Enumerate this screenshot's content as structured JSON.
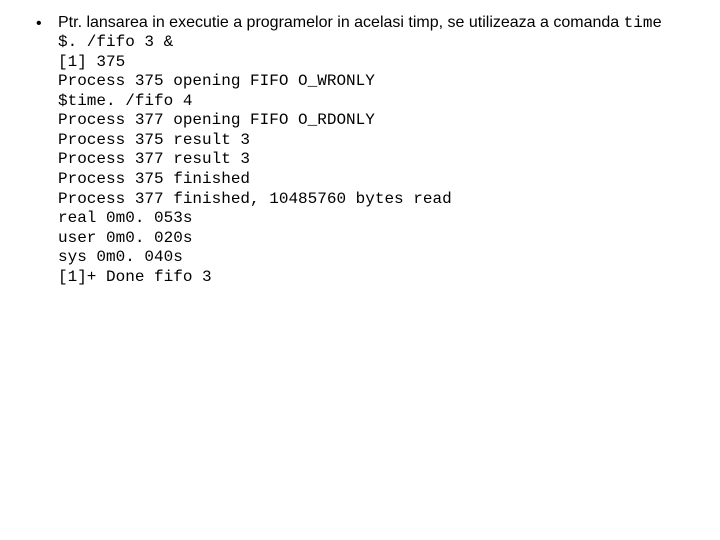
{
  "bullet": "•",
  "intro_part1": "Ptr. lansarea in executie a programelor in acelasi timp, se utilizeaza a comanda ",
  "intro_code": "time",
  "lines": [
    "$. /fifo 3 &",
    "[1] 375",
    "Process 375 opening FIFO O_WRONLY",
    "$time. /fifo 4",
    "Process 377 opening FIFO O_RDONLY",
    "Process 375 result 3",
    "Process 377 result 3",
    "Process 375 finished",
    "Process 377 finished, 10485760 bytes read",
    "real 0m0. 053s",
    "user 0m0. 020s",
    "sys 0m0. 040s",
    "[1]+ Done fifo 3"
  ]
}
